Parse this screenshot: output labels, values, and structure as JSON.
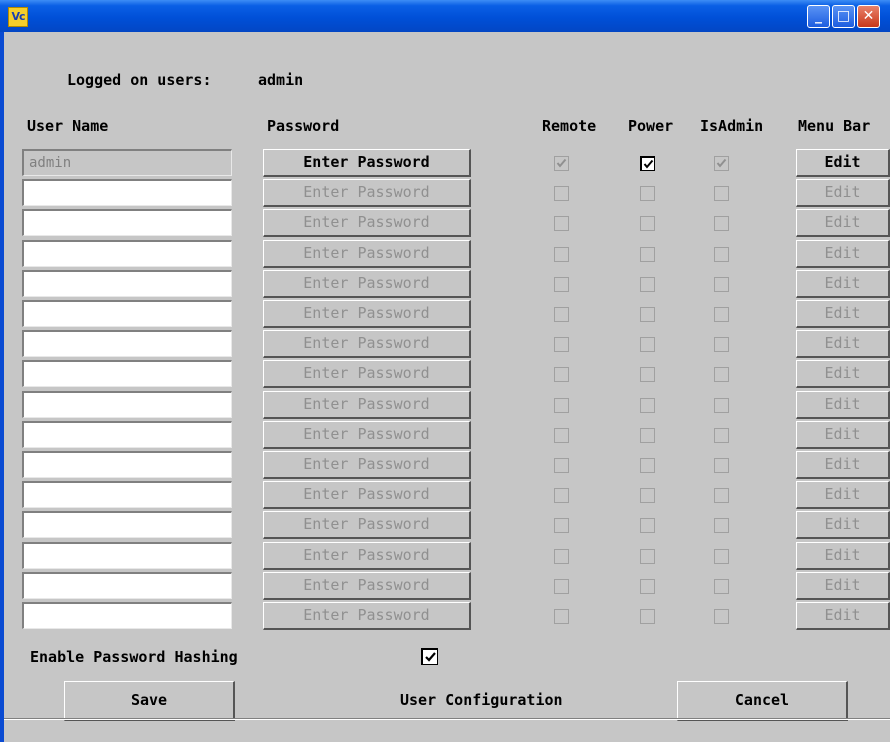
{
  "window": {
    "icon_text": "Vc",
    "controls": {
      "minimize": "_",
      "maximize": "□",
      "close": "✕"
    }
  },
  "header": {
    "logged_on_label": "Logged on users:",
    "logged_on_value": "admin"
  },
  "columns": {
    "user_name": "User Name",
    "password": "Password",
    "remote": "Remote",
    "power": "Power",
    "isadmin": "IsAdmin",
    "menu_bar": "Menu Bar"
  },
  "rows": [
    {
      "user": "admin",
      "password_label": "Enter Password",
      "edit_label": "Edit",
      "enabled": true,
      "remote": true,
      "power": true,
      "isadmin": true
    },
    {
      "user": "",
      "password_label": "Enter Password",
      "edit_label": "Edit",
      "enabled": false,
      "remote": false,
      "power": false,
      "isadmin": false
    },
    {
      "user": "",
      "password_label": "Enter Password",
      "edit_label": "Edit",
      "enabled": false,
      "remote": false,
      "power": false,
      "isadmin": false
    },
    {
      "user": "",
      "password_label": "Enter Password",
      "edit_label": "Edit",
      "enabled": false,
      "remote": false,
      "power": false,
      "isadmin": false
    },
    {
      "user": "",
      "password_label": "Enter Password",
      "edit_label": "Edit",
      "enabled": false,
      "remote": false,
      "power": false,
      "isadmin": false
    },
    {
      "user": "",
      "password_label": "Enter Password",
      "edit_label": "Edit",
      "enabled": false,
      "remote": false,
      "power": false,
      "isadmin": false
    },
    {
      "user": "",
      "password_label": "Enter Password",
      "edit_label": "Edit",
      "enabled": false,
      "remote": false,
      "power": false,
      "isadmin": false
    },
    {
      "user": "",
      "password_label": "Enter Password",
      "edit_label": "Edit",
      "enabled": false,
      "remote": false,
      "power": false,
      "isadmin": false
    },
    {
      "user": "",
      "password_label": "Enter Password",
      "edit_label": "Edit",
      "enabled": false,
      "remote": false,
      "power": false,
      "isadmin": false
    },
    {
      "user": "",
      "password_label": "Enter Password",
      "edit_label": "Edit",
      "enabled": false,
      "remote": false,
      "power": false,
      "isadmin": false
    },
    {
      "user": "",
      "password_label": "Enter Password",
      "edit_label": "Edit",
      "enabled": false,
      "remote": false,
      "power": false,
      "isadmin": false
    },
    {
      "user": "",
      "password_label": "Enter Password",
      "edit_label": "Edit",
      "enabled": false,
      "remote": false,
      "power": false,
      "isadmin": false
    },
    {
      "user": "",
      "password_label": "Enter Password",
      "edit_label": "Edit",
      "enabled": false,
      "remote": false,
      "power": false,
      "isadmin": false
    },
    {
      "user": "",
      "password_label": "Enter Password",
      "edit_label": "Edit",
      "enabled": false,
      "remote": false,
      "power": false,
      "isadmin": false
    },
    {
      "user": "",
      "password_label": "Enter Password",
      "edit_label": "Edit",
      "enabled": false,
      "remote": false,
      "power": false,
      "isadmin": false
    },
    {
      "user": "",
      "password_label": "Enter Password",
      "edit_label": "Edit",
      "enabled": false,
      "remote": false,
      "power": false,
      "isadmin": false
    }
  ],
  "hashing": {
    "label": "Enable Password Hashing",
    "checked": true
  },
  "footer": {
    "save_label": "Save",
    "title": "User Configuration",
    "cancel_label": "Cancel"
  },
  "colors": {
    "titlebar": "#0050d8",
    "background": "#c6c6c6"
  }
}
